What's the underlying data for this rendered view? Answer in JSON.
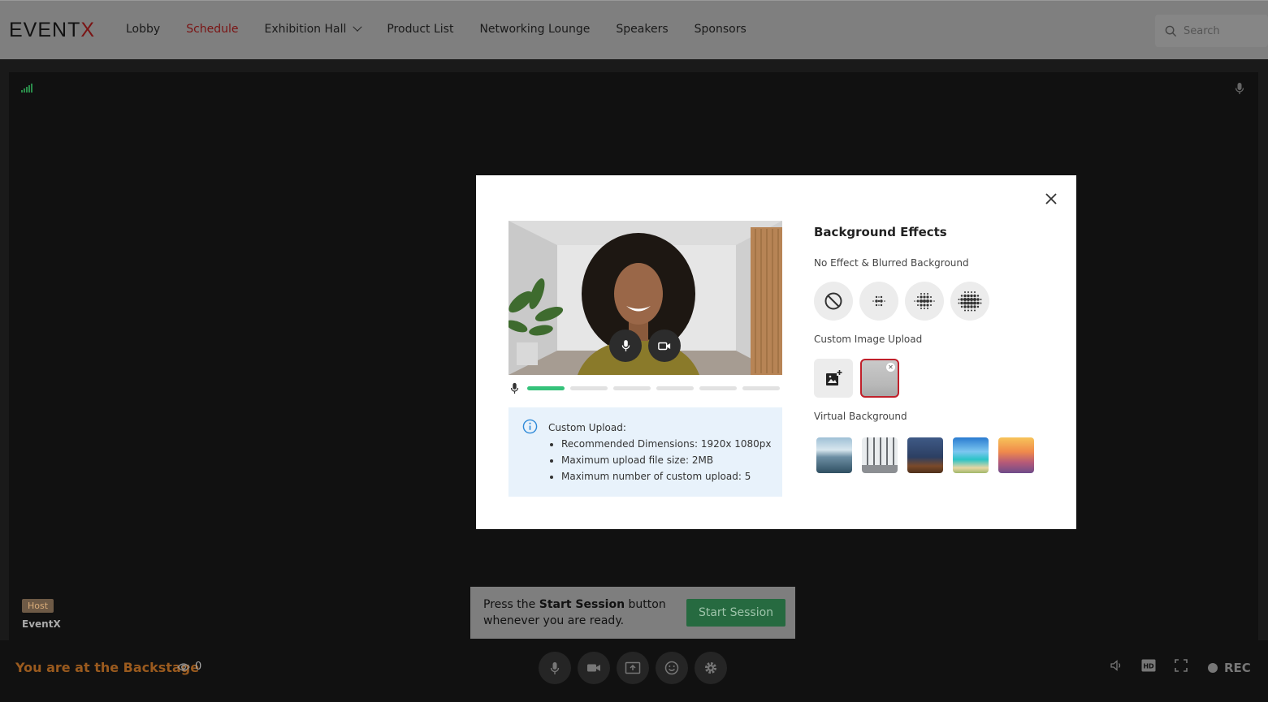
{
  "brand": {
    "logo_main": "EVENT",
    "logo_x": "X"
  },
  "nav": {
    "items": [
      {
        "label": "Lobby",
        "active": false
      },
      {
        "label": "Schedule",
        "active": true
      },
      {
        "label": "Exhibition Hall",
        "active": false,
        "dropdown": true
      },
      {
        "label": "Product List",
        "active": false
      },
      {
        "label": "Networking Lounge",
        "active": false
      },
      {
        "label": "Speakers",
        "active": false
      },
      {
        "label": "Sponsors",
        "active": false
      }
    ],
    "search_placeholder": "Search"
  },
  "stage": {
    "host_badge": "Host",
    "host_name": "EventX",
    "start_prompt_before": "Press the ",
    "start_prompt_bold": "Start Session",
    "start_prompt_after": " button whenever you are ready.",
    "start_button": "Start Session"
  },
  "bottom": {
    "backstage_label": "You are at the Backstage",
    "viewer_count": "0",
    "rec_label": "REC"
  },
  "modal": {
    "title": "Background Effects",
    "section_effects": "No Effect & Blurred Background",
    "section_custom": "Custom Image Upload",
    "section_virtual": "Virtual Background",
    "mic_level_active_segments": 1,
    "mic_level_total_segments": 6,
    "info": {
      "title": "Custom Upload:",
      "items": [
        "Recommended Dimensions: 1920x 1080px",
        "Maximum upload file size: 2MB",
        "Maximum number of custom upload: 5"
      ]
    }
  },
  "colors": {
    "active_nav": "#7a1414",
    "start_button": "#266a40",
    "backstage_text": "#9a5a1e",
    "selected_border": "#c0202a",
    "mic_level": "#35c27a"
  }
}
